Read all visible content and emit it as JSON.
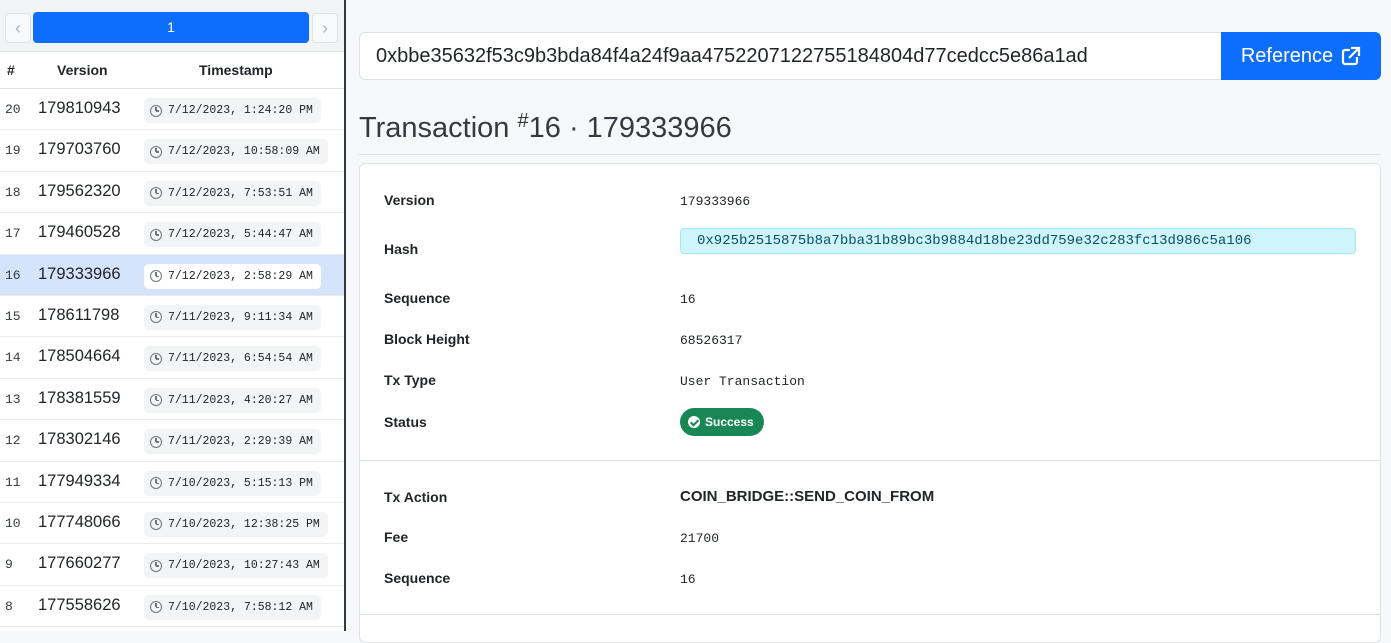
{
  "pager": {
    "prev": "‹",
    "current": "1",
    "next": "›"
  },
  "table": {
    "headers": {
      "num": "#",
      "version": "Version",
      "timestamp": "Timestamp"
    },
    "rows": [
      {
        "num": "20",
        "version": "179810943",
        "timestamp": "7/12/2023, 1:24:20 PM",
        "active": false
      },
      {
        "num": "19",
        "version": "179703760",
        "timestamp": "7/12/2023, 10:58:09 AM",
        "active": false
      },
      {
        "num": "18",
        "version": "179562320",
        "timestamp": "7/12/2023, 7:53:51 AM",
        "active": false
      },
      {
        "num": "17",
        "version": "179460528",
        "timestamp": "7/12/2023, 5:44:47 AM",
        "active": false
      },
      {
        "num": "16",
        "version": "179333966",
        "timestamp": "7/12/2023, 2:58:29 AM",
        "active": true
      },
      {
        "num": "15",
        "version": "178611798",
        "timestamp": "7/11/2023, 9:11:34 AM",
        "active": false
      },
      {
        "num": "14",
        "version": "178504664",
        "timestamp": "7/11/2023, 6:54:54 AM",
        "active": false
      },
      {
        "num": "13",
        "version": "178381559",
        "timestamp": "7/11/2023, 4:20:27 AM",
        "active": false
      },
      {
        "num": "12",
        "version": "178302146",
        "timestamp": "7/11/2023, 2:29:39 AM",
        "active": false
      },
      {
        "num": "11",
        "version": "177949334",
        "timestamp": "7/10/2023, 5:15:13 PM",
        "active": false
      },
      {
        "num": "10",
        "version": "177748066",
        "timestamp": "7/10/2023, 12:38:25 PM",
        "active": false
      },
      {
        "num": "9",
        "version": "177660277",
        "timestamp": "7/10/2023, 10:27:43 AM",
        "active": false
      },
      {
        "num": "8",
        "version": "177558626",
        "timestamp": "7/10/2023, 7:58:12 AM",
        "active": false
      }
    ]
  },
  "search": {
    "value": "0xbbe35632f53c9b3bda84f4a24f9aa4752207122755184804d77cedcc5e86a1ad"
  },
  "reference_button": {
    "label": "Reference",
    "icon": "external-link-icon"
  },
  "title": {
    "prefix": "Transaction ",
    "hash_sign": "#",
    "rest": "16 · 179333966"
  },
  "details": {
    "version_label": "Version",
    "version": "179333966",
    "hash_label": "Hash",
    "hash": "0x925b2515875b8a7bba31b89bc3b9884d18be23dd759e32c283fc13d986c5a106",
    "sequence_label": "Sequence",
    "sequence": "16",
    "block_height_label": "Block Height",
    "block_height": "68526317",
    "tx_type_label": "Tx Type",
    "tx_type": "User Transaction",
    "status_label": "Status",
    "status": "Success",
    "tx_action_label": "Tx Action",
    "tx_action": "COIN_BRIDGE::SEND_COIN_FROM",
    "fee_label": "Fee",
    "fee": "21700",
    "sequence2_label": "Sequence",
    "sequence2": "16"
  },
  "colors": {
    "accent": "#0d6efd",
    "active_row": "#d5e3fb",
    "success": "#198754",
    "hash_bg": "#cff4fc"
  }
}
